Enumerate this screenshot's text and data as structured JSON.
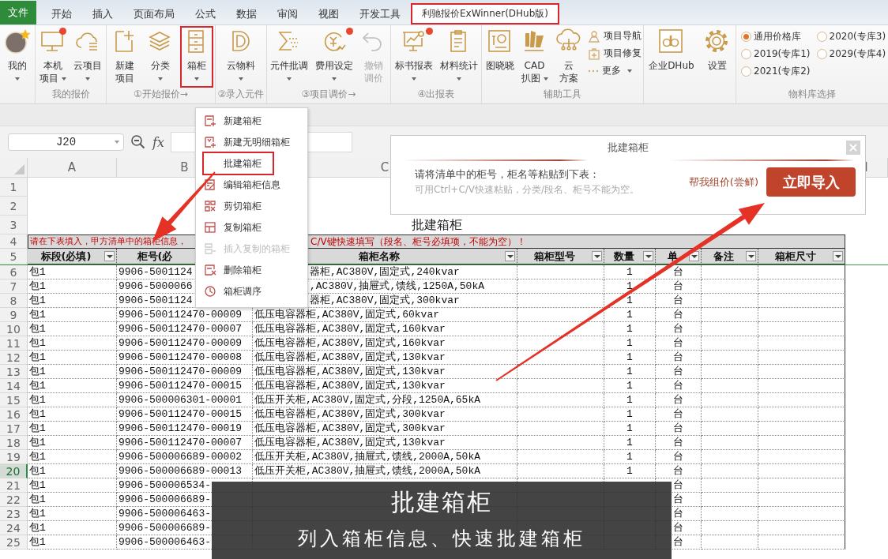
{
  "tabs": [
    {
      "label": "文件",
      "kind": "file",
      "selected": false
    },
    {
      "label": "开始",
      "kind": "tab",
      "selected": false
    },
    {
      "label": "插入",
      "kind": "tab",
      "selected": false
    },
    {
      "label": "页面布局",
      "kind": "tab",
      "selected": false
    },
    {
      "label": "公式",
      "kind": "tab",
      "selected": false
    },
    {
      "label": "数据",
      "kind": "tab",
      "selected": false
    },
    {
      "label": "审阅",
      "kind": "tab",
      "selected": false
    },
    {
      "label": "视图",
      "kind": "tab",
      "selected": false
    },
    {
      "label": "开发工具",
      "kind": "tab",
      "selected": false
    },
    {
      "label": "利驰报价ExWinner(DHub版)",
      "kind": "tab",
      "selected": true
    }
  ],
  "ribbon": {
    "groups": [
      {
        "buttons": [
          {
            "lines": [
              "我的"
            ],
            "dropdown": true,
            "badge": false,
            "highlighted": false,
            "disabled": false
          }
        ]
      },
      {
        "label": "我的报价",
        "buttons": [
          {
            "lines": [
              "本机",
              "项目"
            ],
            "dropdown": true,
            "badge": true,
            "highlighted": false,
            "disabled": false
          },
          {
            "lines": [
              "云项目"
            ],
            "dropdown": true,
            "badge": false,
            "highlighted": false,
            "disabled": false
          }
        ]
      },
      {
        "label": "①开始报价→",
        "buttons": [
          {
            "lines": [
              "新建",
              "项目"
            ],
            "dropdown": false,
            "badge": false,
            "highlighted": false,
            "disabled": false
          },
          {
            "lines": [
              "分类"
            ],
            "dropdown": true,
            "badge": false,
            "highlighted": false,
            "disabled": false
          },
          {
            "lines": [
              "箱柜"
            ],
            "dropdown": true,
            "badge": false,
            "highlighted": true,
            "disabled": false
          }
        ]
      },
      {
        "label": "②录入元件",
        "buttons": [
          {
            "lines": [
              "云物料"
            ],
            "dropdown": true,
            "badge": false,
            "highlighted": false,
            "disabled": false
          }
        ]
      },
      {
        "label": "③项目调价→",
        "buttons": [
          {
            "lines": [
              "元件批调"
            ],
            "dropdown": true,
            "badge": false,
            "highlighted": false,
            "disabled": false
          },
          {
            "lines": [
              "费用设定"
            ],
            "dropdown": true,
            "badge": true,
            "highlighted": false,
            "disabled": false
          },
          {
            "lines": [
              "撤销",
              "调价"
            ],
            "dropdown": false,
            "badge": false,
            "highlighted": false,
            "disabled": true
          }
        ]
      },
      {
        "label": "④出报表",
        "buttons": [
          {
            "lines": [
              "标书报表"
            ],
            "dropdown": true,
            "badge": true,
            "highlighted": false,
            "disabled": false
          },
          {
            "lines": [
              "材料统计"
            ],
            "dropdown": true,
            "badge": false,
            "highlighted": false,
            "disabled": false
          }
        ]
      },
      {
        "label": "辅助工具",
        "buttons": [
          {
            "lines": [
              "图晓晓"
            ],
            "dropdown": false,
            "badge": false,
            "highlighted": false,
            "disabled": false
          },
          {
            "lines": [
              "CAD",
              "扒图"
            ],
            "dropdown": true,
            "badge": false,
            "highlighted": false,
            "disabled": false
          },
          {
            "lines": [
              "云",
              "方案"
            ],
            "dropdown": false,
            "badge": false,
            "highlighted": false,
            "disabled": false
          }
        ],
        "small_buttons": [
          {
            "label": "项目导航",
            "dropdown": false
          },
          {
            "label": "项目修复",
            "dropdown": false
          },
          {
            "label": "更多",
            "dropdown": true
          }
        ]
      },
      {
        "buttons": [
          {
            "lines": [
              "企业DHub"
            ],
            "dropdown": false,
            "badge": false,
            "highlighted": false,
            "disabled": false
          },
          {
            "lines": [
              "设置"
            ],
            "dropdown": false,
            "badge": false,
            "highlighted": false,
            "disabled": false
          }
        ]
      },
      {
        "label": "物料库选择",
        "radios": [
          {
            "label": "通用价格库",
            "selected": true
          },
          {
            "label": "2020(专库3)",
            "selected": false
          },
          {
            "label": "2019(专库1)",
            "selected": false
          },
          {
            "label": "2029(专库4)",
            "selected": false
          },
          {
            "label": "2021(专库2)",
            "selected": false
          }
        ]
      }
    ]
  },
  "sheet": {
    "name_box": "J20",
    "formula_label": "fx",
    "column_headers": [
      {
        "label": "A"
      },
      {
        "label": "B"
      },
      {
        "label": "C"
      },
      {
        "label": "I"
      }
    ],
    "title_rows": [
      "1",
      "2",
      "3"
    ],
    "title": "批建箱柜",
    "note": {
      "number": "4",
      "left": "请在下表填入，甲方清单中的箱柜信息，",
      "right": "C/V键快速填写（段名、柜号必填项，不能为空）！"
    },
    "header_row": {
      "number": "5",
      "columns": [
        {
          "text": "标段(必填)",
          "filter": true,
          "covered": false
        },
        {
          "text": "柜号(必",
          "filter": false,
          "covered": true
        },
        {
          "text": "箱柜名称",
          "filter": true,
          "covered": false
        },
        {
          "text": "箱柜型号",
          "filter": true,
          "covered": false
        },
        {
          "text": "数量",
          "filter": true,
          "covered": false
        },
        {
          "text": "单",
          "filter": true,
          "covered": false
        },
        {
          "text": "备注",
          "filter": true,
          "covered": false
        },
        {
          "text": "箱柜尺寸",
          "filter": true,
          "covered": false
        }
      ]
    },
    "rows": [
      {
        "number": "6",
        "selected": false,
        "covered": true,
        "segment": "包1",
        "cabinet_no": "9906-5001124",
        "cabinet_name": "器柜,AC380V,固定式,240kvar",
        "quantity": "1",
        "unit": "台"
      },
      {
        "number": "7",
        "selected": false,
        "covered": true,
        "segment": "包1",
        "cabinet_no": "9906-5000066",
        "cabinet_name": ",AC380V,抽屉式,馈线,1250A,50kA",
        "quantity": "1",
        "unit": "台"
      },
      {
        "number": "8",
        "selected": false,
        "covered": true,
        "segment": "包1",
        "cabinet_no": "9906-5001124",
        "cabinet_name": "器柜,AC380V,固定式,300kvar",
        "quantity": "1",
        "unit": "台"
      },
      {
        "number": "9",
        "selected": false,
        "covered": false,
        "segment": "包1",
        "cabinet_no": "9906-500112470-00009",
        "cabinet_name": "低压电容器柜,AC380V,固定式,60kvar",
        "quantity": "1",
        "unit": "台"
      },
      {
        "number": "10",
        "selected": false,
        "covered": false,
        "segment": "包1",
        "cabinet_no": "9906-500112470-00007",
        "cabinet_name": "低压电容器柜,AC380V,固定式,160kvar",
        "quantity": "1",
        "unit": "台"
      },
      {
        "number": "11",
        "selected": false,
        "covered": false,
        "segment": "包1",
        "cabinet_no": "9906-500112470-00009",
        "cabinet_name": "低压电容器柜,AC380V,固定式,160kvar",
        "quantity": "1",
        "unit": "台"
      },
      {
        "number": "12",
        "selected": false,
        "covered": false,
        "segment": "包1",
        "cabinet_no": "9906-500112470-00008",
        "cabinet_name": "低压电容器柜,AC380V,固定式,130kvar",
        "quantity": "1",
        "unit": "台"
      },
      {
        "number": "13",
        "selected": false,
        "covered": false,
        "segment": "包1",
        "cabinet_no": "9906-500112470-00009",
        "cabinet_name": "低压电容器柜,AC380V,固定式,130kvar",
        "quantity": "1",
        "unit": "台"
      },
      {
        "number": "14",
        "selected": false,
        "covered": false,
        "segment": "包1",
        "cabinet_no": "9906-500112470-00015",
        "cabinet_name": "低压电容器柜,AC380V,固定式,130kvar",
        "quantity": "1",
        "unit": "台"
      },
      {
        "number": "15",
        "selected": false,
        "covered": false,
        "segment": "包1",
        "cabinet_no": "9906-500006301-00001",
        "cabinet_name": "低压开关柜,AC380V,固定式,分段,1250A,65kA",
        "quantity": "1",
        "unit": "台"
      },
      {
        "number": "16",
        "selected": false,
        "covered": false,
        "segment": "包1",
        "cabinet_no": "9906-500112470-00015",
        "cabinet_name": "低压电容器柜,AC380V,固定式,300kvar",
        "quantity": "1",
        "unit": "台"
      },
      {
        "number": "17",
        "selected": false,
        "covered": false,
        "segment": "包1",
        "cabinet_no": "9906-500112470-00019",
        "cabinet_name": "低压电容器柜,AC380V,固定式,300kvar",
        "quantity": "1",
        "unit": "台"
      },
      {
        "number": "18",
        "selected": false,
        "covered": false,
        "segment": "包1",
        "cabinet_no": "9906-500112470-00007",
        "cabinet_name": "低压电容器柜,AC380V,固定式,130kvar",
        "quantity": "1",
        "unit": "台"
      },
      {
        "number": "19",
        "selected": false,
        "covered": false,
        "segment": "包1",
        "cabinet_no": "9906-500006689-00002",
        "cabinet_name": "低压开关柜,AC380V,抽屉式,馈线,2000A,50kA",
        "quantity": "1",
        "unit": "台"
      },
      {
        "number": "20",
        "selected": true,
        "covered": false,
        "segment": "包1",
        "cabinet_no": "9906-500006689-00013",
        "cabinet_name": "低压开关柜,AC380V,抽屉式,馈线,2000A,50kA",
        "quantity": "1",
        "unit": "台"
      },
      {
        "number": "21",
        "selected": false,
        "segment": "包1",
        "cabinet_no": "9906-500006534-",
        "unit": "台"
      },
      {
        "number": "22",
        "selected": false,
        "segment": "包1",
        "cabinet_no": "9906-500006689-",
        "unit": "台"
      },
      {
        "number": "23",
        "selected": false,
        "segment": "包1",
        "cabinet_no": "9906-500006463-",
        "unit": "台"
      },
      {
        "number": "24",
        "selected": false,
        "segment": "包1",
        "cabinet_no": "9906-500006689-",
        "unit": "台"
      },
      {
        "number": "25",
        "selected": false,
        "segment": "包1",
        "cabinet_no": "9906-500006463-",
        "unit": "台"
      }
    ]
  },
  "dropdown_menu": {
    "items": [
      {
        "label": "新建箱柜",
        "highlighted": false,
        "disabled": false
      },
      {
        "label": "新建无明细箱柜",
        "highlighted": false,
        "disabled": false
      },
      {
        "label": "批建箱柜",
        "highlighted": true,
        "disabled": false
      },
      {
        "label": "编辑箱柜信息",
        "highlighted": false,
        "disabled": false
      },
      {
        "label": "剪切箱柜",
        "highlighted": false,
        "disabled": false
      },
      {
        "label": "复制箱柜",
        "highlighted": false,
        "disabled": false
      },
      {
        "label": "插入复制的箱柜",
        "highlighted": false,
        "disabled": true
      },
      {
        "label": "删除箱柜",
        "highlighted": false,
        "disabled": false
      },
      {
        "label": "箱柜调序",
        "highlighted": false,
        "disabled": false
      }
    ]
  },
  "dialog": {
    "title": "批建箱柜",
    "message": "请将清单中的柜号，柜名等粘贴到下表：",
    "hint": "可用Ctrl+C/V快速粘贴，分类/段名、柜号不能为空。",
    "link": "帮我组价(尝鲜)",
    "button": "立即导入"
  },
  "caption": {
    "title": "批建箱柜",
    "subtitle": "列入箱柜信息、快速批建箱柜"
  }
}
